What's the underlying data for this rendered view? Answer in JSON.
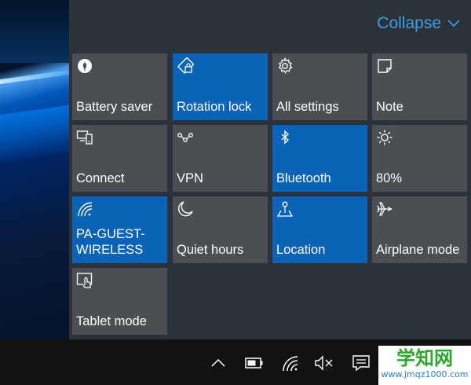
{
  "header": {
    "collapse_label": "Collapse",
    "collapse_icon": "chevron-down-icon"
  },
  "tiles": [
    {
      "label": "Battery saver",
      "icon": "leaf-icon",
      "active": false
    },
    {
      "label": "Rotation lock",
      "icon": "rotation-lock-icon",
      "active": true
    },
    {
      "label": "All settings",
      "icon": "gear-icon",
      "active": false
    },
    {
      "label": "Note",
      "icon": "note-icon",
      "active": false
    },
    {
      "label": "Connect",
      "icon": "connect-icon",
      "active": false
    },
    {
      "label": "VPN",
      "icon": "vpn-icon",
      "active": false
    },
    {
      "label": "Bluetooth",
      "icon": "bluetooth-icon",
      "active": true
    },
    {
      "label": "80%",
      "icon": "brightness-icon",
      "active": false
    },
    {
      "label": "PA-GUEST-\nWIRELESS",
      "icon": "wifi-icon",
      "active": true
    },
    {
      "label": "Quiet hours",
      "icon": "moon-icon",
      "active": false
    },
    {
      "label": "Location",
      "icon": "location-icon",
      "active": true
    },
    {
      "label": "Airplane mode",
      "icon": "airplane-icon",
      "active": false
    },
    {
      "label": "Tablet mode",
      "icon": "tablet-mode-icon",
      "active": false
    }
  ],
  "taskbar": {
    "icons": [
      "chevron-up-icon",
      "battery-icon",
      "wifi-icon",
      "volume-muted-icon",
      "notification-icon"
    ]
  },
  "watermark": {
    "title": "学知网",
    "url": "www.jmqz1000.com"
  },
  "colors": {
    "panel": "#2c3239",
    "tile": "#4b4f54",
    "tile_active": "#0b63b8",
    "accent": "#3a9de6",
    "taskbar": "#101214"
  }
}
